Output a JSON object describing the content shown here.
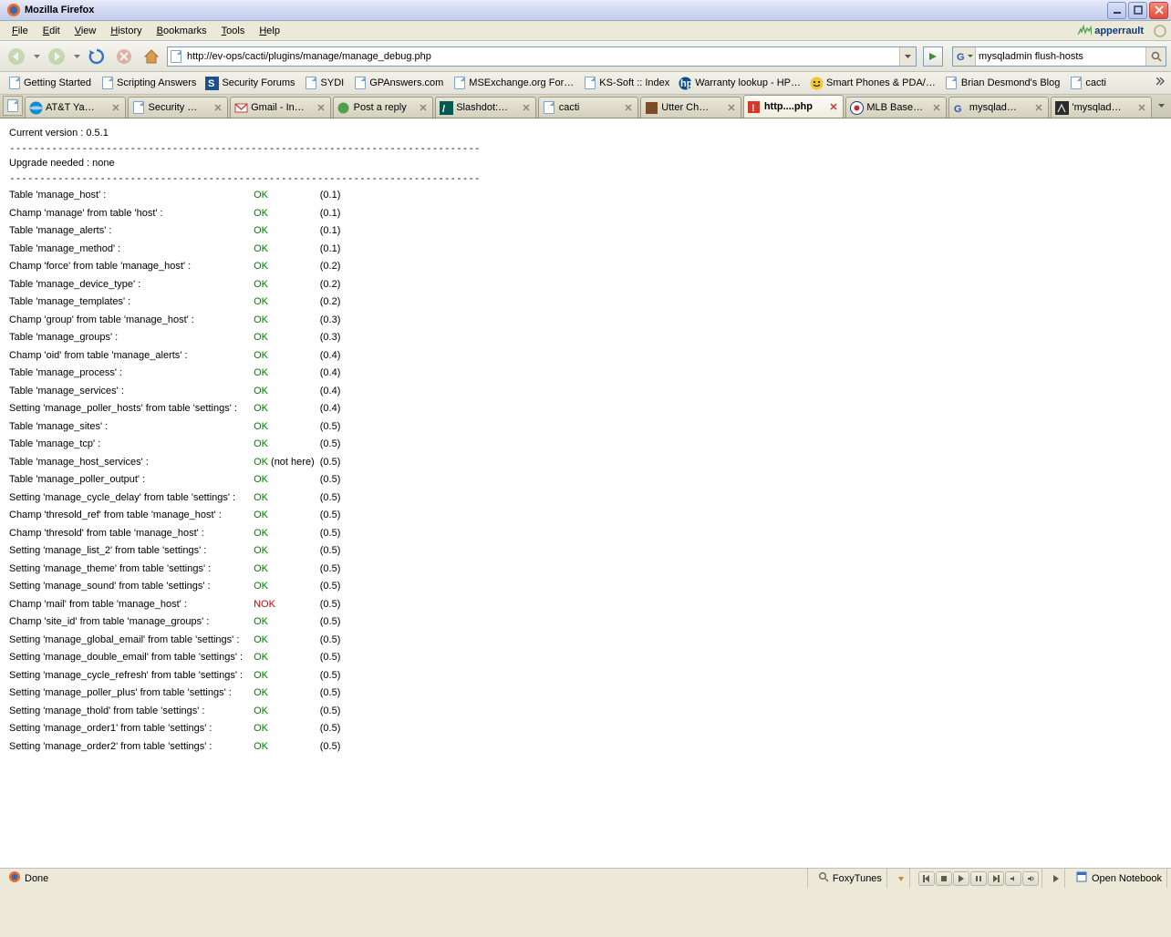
{
  "window": {
    "title": "Mozilla Firefox"
  },
  "menus": [
    "File",
    "Edit",
    "View",
    "History",
    "Bookmarks",
    "Tools",
    "Help"
  ],
  "apperrault": "apperrault",
  "url": "http://ev-ops/cacti/plugins/manage/manage_debug.php",
  "search": "mysqladmin flush-hosts",
  "bookmarks": [
    {
      "label": "Getting Started",
      "icon": "page"
    },
    {
      "label": "Scripting Answers",
      "icon": "page"
    },
    {
      "label": "Security Forums",
      "icon": "sf"
    },
    {
      "label": "SYDI",
      "icon": "page"
    },
    {
      "label": "GPAnswers.com",
      "icon": "page"
    },
    {
      "label": "MSExchange.org For…",
      "icon": "page"
    },
    {
      "label": "KS-Soft :: Index",
      "icon": "page"
    },
    {
      "label": "Warranty lookup - HP…",
      "icon": "hp"
    },
    {
      "label": "Smart Phones & PDA/…",
      "icon": "smile"
    },
    {
      "label": "Brian Desmond's Blog",
      "icon": "page"
    },
    {
      "label": "cacti",
      "icon": "page"
    }
  ],
  "tabs": [
    {
      "label": "AT&T Ya…",
      "icon": "att"
    },
    {
      "label": "Security …",
      "icon": "page"
    },
    {
      "label": "Gmail - In…",
      "icon": "gmail"
    },
    {
      "label": "Post a reply",
      "icon": "green"
    },
    {
      "label": "Slashdot:…",
      "icon": "slash"
    },
    {
      "label": "cacti",
      "icon": "page"
    },
    {
      "label": "Utter Ch…",
      "icon": "brown"
    },
    {
      "label": "http....php",
      "icon": "warn",
      "active": true
    },
    {
      "label": "MLB Base…",
      "icon": "mlb"
    },
    {
      "label": "mysqlad…",
      "icon": "google"
    },
    {
      "label": "'mysqlad…",
      "icon": "dark"
    }
  ],
  "page": {
    "version_line": "Current version : 0.5.1",
    "divider": "------------------------------------------------------------------------------",
    "upgrade_line": "Upgrade needed : none",
    "rows": [
      {
        "label": "Table 'manage_host' :",
        "status": "OK",
        "note": "",
        "ver": "(0.1)"
      },
      {
        "label": "Champ 'manage' from table 'host' :",
        "status": "OK",
        "note": "",
        "ver": "(0.1)"
      },
      {
        "label": "Table 'manage_alerts' :",
        "status": "OK",
        "note": "",
        "ver": "(0.1)"
      },
      {
        "label": "Table 'manage_method' :",
        "status": "OK",
        "note": "",
        "ver": "(0.1)"
      },
      {
        "label": "Champ 'force' from table 'manage_host' :",
        "status": "OK",
        "note": "",
        "ver": "(0.2)"
      },
      {
        "label": "Table 'manage_device_type' :",
        "status": "OK",
        "note": "",
        "ver": "(0.2)"
      },
      {
        "label": "Table 'manage_templates' :",
        "status": "OK",
        "note": "",
        "ver": "(0.2)"
      },
      {
        "label": "Champ 'group' from table 'manage_host' :",
        "status": "OK",
        "note": "",
        "ver": "(0.3)"
      },
      {
        "label": "Table 'manage_groups' :",
        "status": "OK",
        "note": "",
        "ver": "(0.3)"
      },
      {
        "label": "Champ 'oid' from table 'manage_alerts' :",
        "status": "OK",
        "note": "",
        "ver": "(0.4)"
      },
      {
        "label": "Table 'manage_process' :",
        "status": "OK",
        "note": "",
        "ver": "(0.4)"
      },
      {
        "label": "Table 'manage_services' :",
        "status": "OK",
        "note": "",
        "ver": "(0.4)"
      },
      {
        "label": "Setting 'manage_poller_hosts' from table 'settings' :",
        "status": "OK",
        "note": "",
        "ver": "(0.4)"
      },
      {
        "label": "Table 'manage_sites' :",
        "status": "OK",
        "note": "",
        "ver": "(0.5)"
      },
      {
        "label": "Table 'manage_tcp' :",
        "status": "OK",
        "note": "",
        "ver": "(0.5)"
      },
      {
        "label": "Table 'manage_host_services' :",
        "status": "OK",
        "note": "(not here)",
        "ver": "(0.5)"
      },
      {
        "label": "Table 'manage_poller_output' :",
        "status": "OK",
        "note": "",
        "ver": "(0.5)"
      },
      {
        "label": "Setting 'manage_cycle_delay' from table 'settings' :",
        "status": "OK",
        "note": "",
        "ver": "(0.5)"
      },
      {
        "label": "Champ 'thresold_ref' from table 'manage_host' :",
        "status": "OK",
        "note": "",
        "ver": "(0.5)"
      },
      {
        "label": "Champ 'thresold' from table 'manage_host' :",
        "status": "OK",
        "note": "",
        "ver": "(0.5)"
      },
      {
        "label": "Setting 'manage_list_2' from table 'settings' :",
        "status": "OK",
        "note": "",
        "ver": "(0.5)"
      },
      {
        "label": "Setting 'manage_theme' from table 'settings' :",
        "status": "OK",
        "note": "",
        "ver": "(0.5)"
      },
      {
        "label": "Setting 'manage_sound' from table 'settings' :",
        "status": "OK",
        "note": "",
        "ver": "(0.5)"
      },
      {
        "label": "Champ 'mail' from table 'manage_host' :",
        "status": "NOK",
        "note": "",
        "ver": "(0.5)"
      },
      {
        "label": "Champ 'site_id' from table 'manage_groups' :",
        "status": "OK",
        "note": "",
        "ver": "(0.5)"
      },
      {
        "label": "Setting 'manage_global_email' from table 'settings' :",
        "status": "OK",
        "note": "",
        "ver": "(0.5)"
      },
      {
        "label": "Setting 'manage_double_email' from table 'settings' :",
        "status": "OK",
        "note": "",
        "ver": "(0.5)"
      },
      {
        "label": "Setting 'manage_cycle_refresh' from table 'settings' :",
        "status": "OK",
        "note": "",
        "ver": "(0.5)"
      },
      {
        "label": "Setting 'manage_poller_plus' from table 'settings' :",
        "status": "OK",
        "note": "",
        "ver": "(0.5)"
      },
      {
        "label": "Setting 'manage_thold' from table 'settings' :",
        "status": "OK",
        "note": "",
        "ver": "(0.5)"
      },
      {
        "label": "Setting 'manage_order1' from table 'settings' :",
        "status": "OK",
        "note": "",
        "ver": "(0.5)"
      },
      {
        "label": "Setting 'manage_order2' from table 'settings' :",
        "status": "OK",
        "note": "",
        "ver": "(0.5)"
      }
    ]
  },
  "status": {
    "done": "Done",
    "foxytunes": "FoxyTunes",
    "notebook": "Open Notebook"
  },
  "colors": {
    "ok": "#008000",
    "nok": "#cc0000"
  }
}
